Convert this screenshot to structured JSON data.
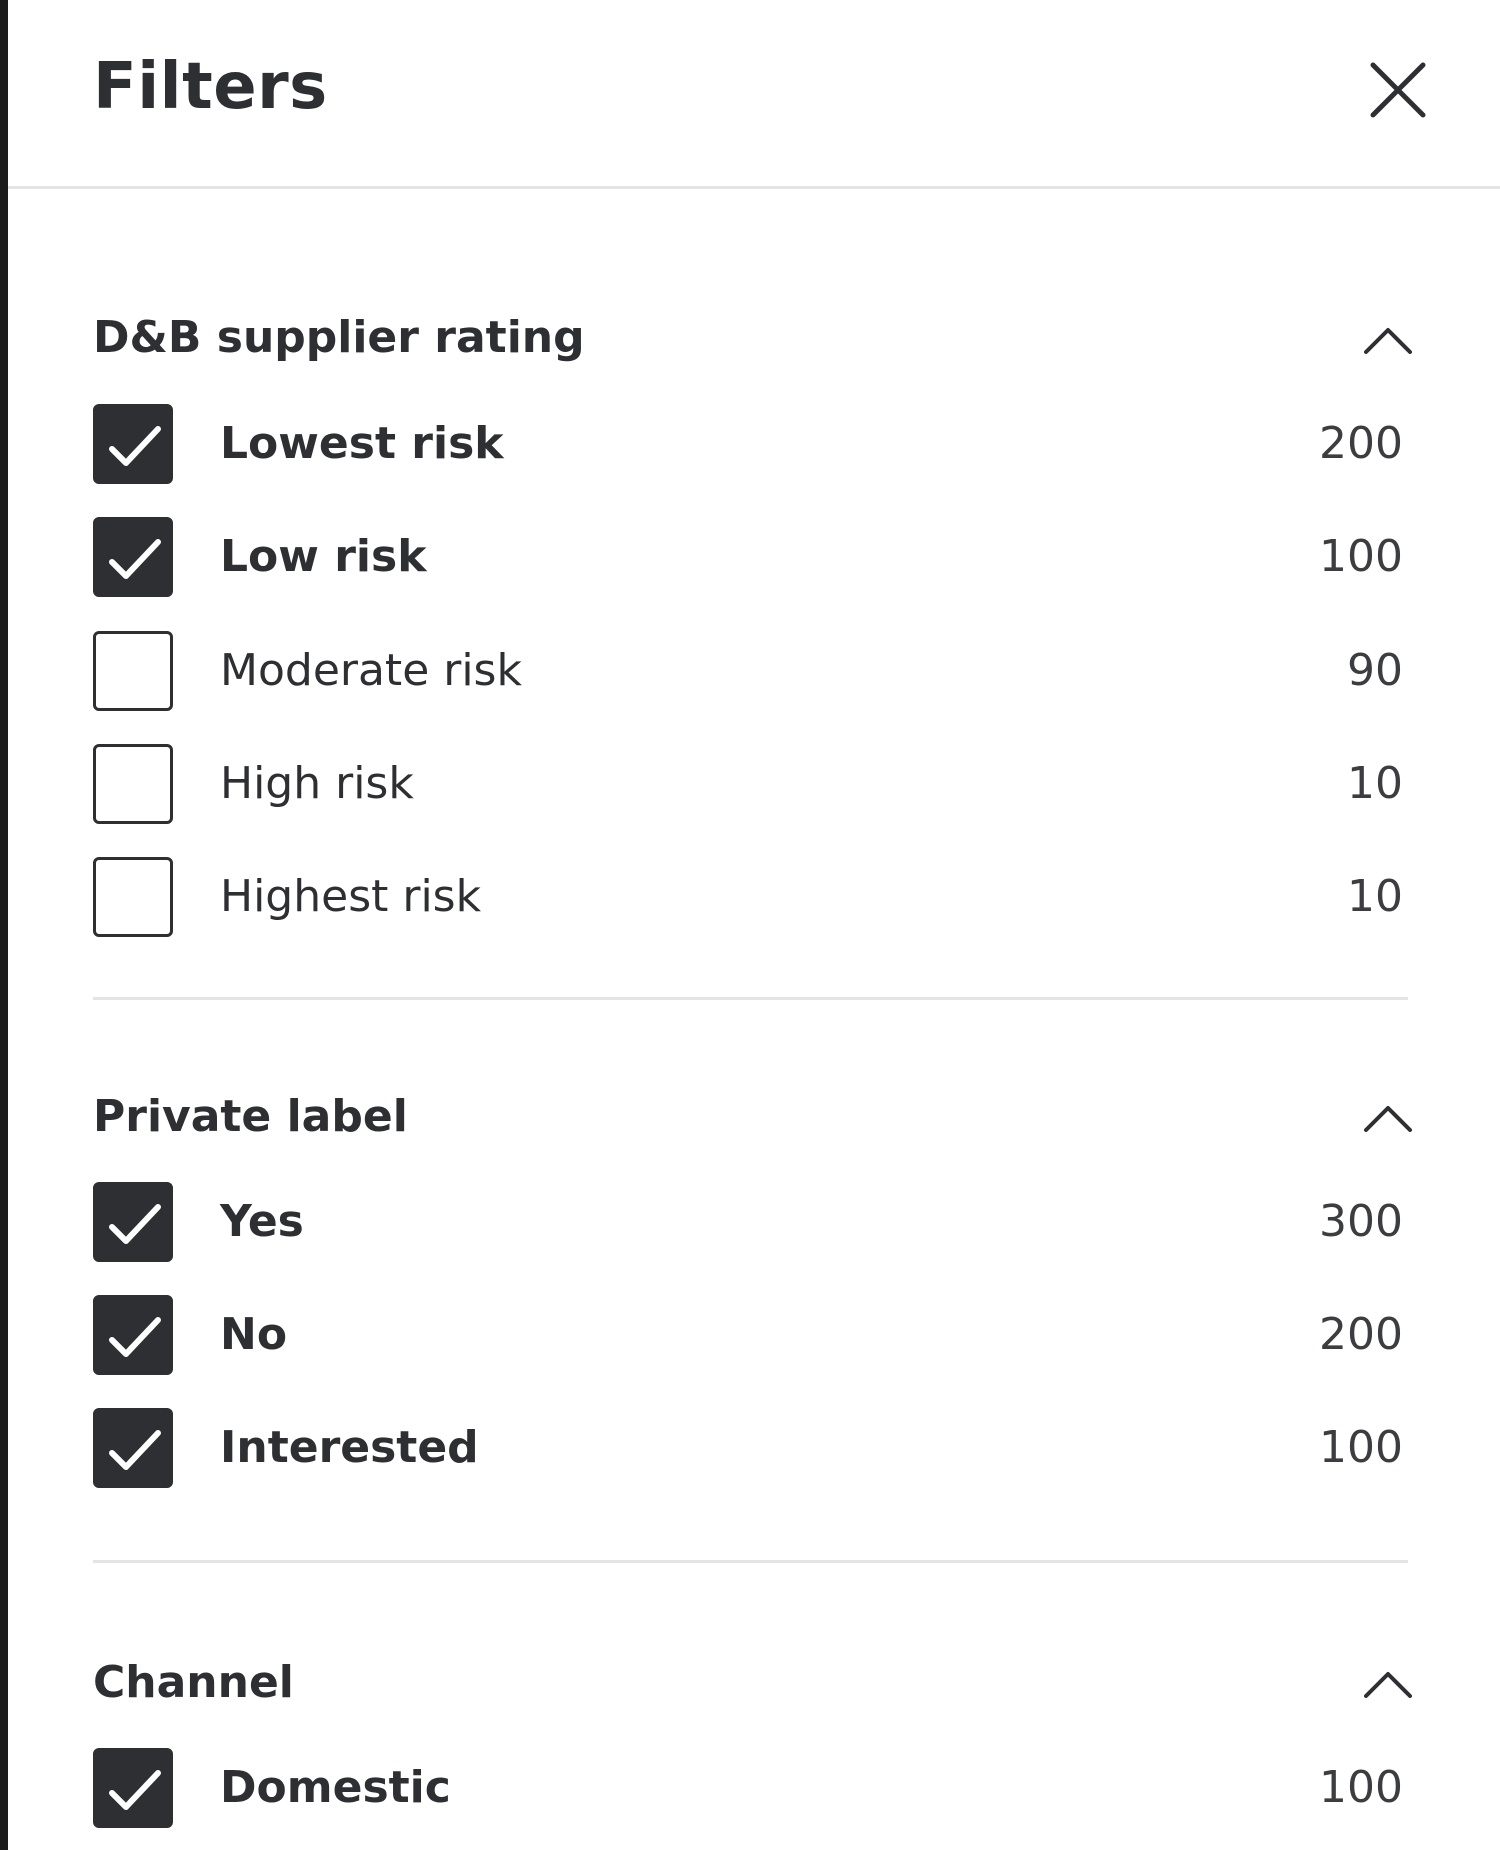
{
  "header": {
    "title": "Filters"
  },
  "sections": [
    {
      "title": "D&B supplier rating",
      "items": [
        {
          "label": "Lowest risk",
          "count": "200",
          "checked": true
        },
        {
          "label": "Low risk",
          "count": "100",
          "checked": true
        },
        {
          "label": "Moderate risk",
          "count": "90",
          "checked": false
        },
        {
          "label": "High risk",
          "count": "10",
          "checked": false
        },
        {
          "label": "Highest risk",
          "count": "10",
          "checked": false
        }
      ]
    },
    {
      "title": "Private label",
      "items": [
        {
          "label": "Yes",
          "count": "300",
          "checked": true
        },
        {
          "label": "No",
          "count": "200",
          "checked": true
        },
        {
          "label": "Interested",
          "count": "100",
          "checked": true
        }
      ]
    },
    {
      "title": "Channel",
      "items": [
        {
          "label": "Domestic",
          "count": "100",
          "checked": true
        }
      ]
    }
  ],
  "icons": {
    "close": "close-icon",
    "collapse": "chevron-up-icon",
    "check": "checkmark-icon"
  },
  "colors": {
    "text": "#2e2f32",
    "checkbox_fill": "#2e2f32",
    "divider": "#e3e4e5",
    "background": "#ffffff"
  }
}
